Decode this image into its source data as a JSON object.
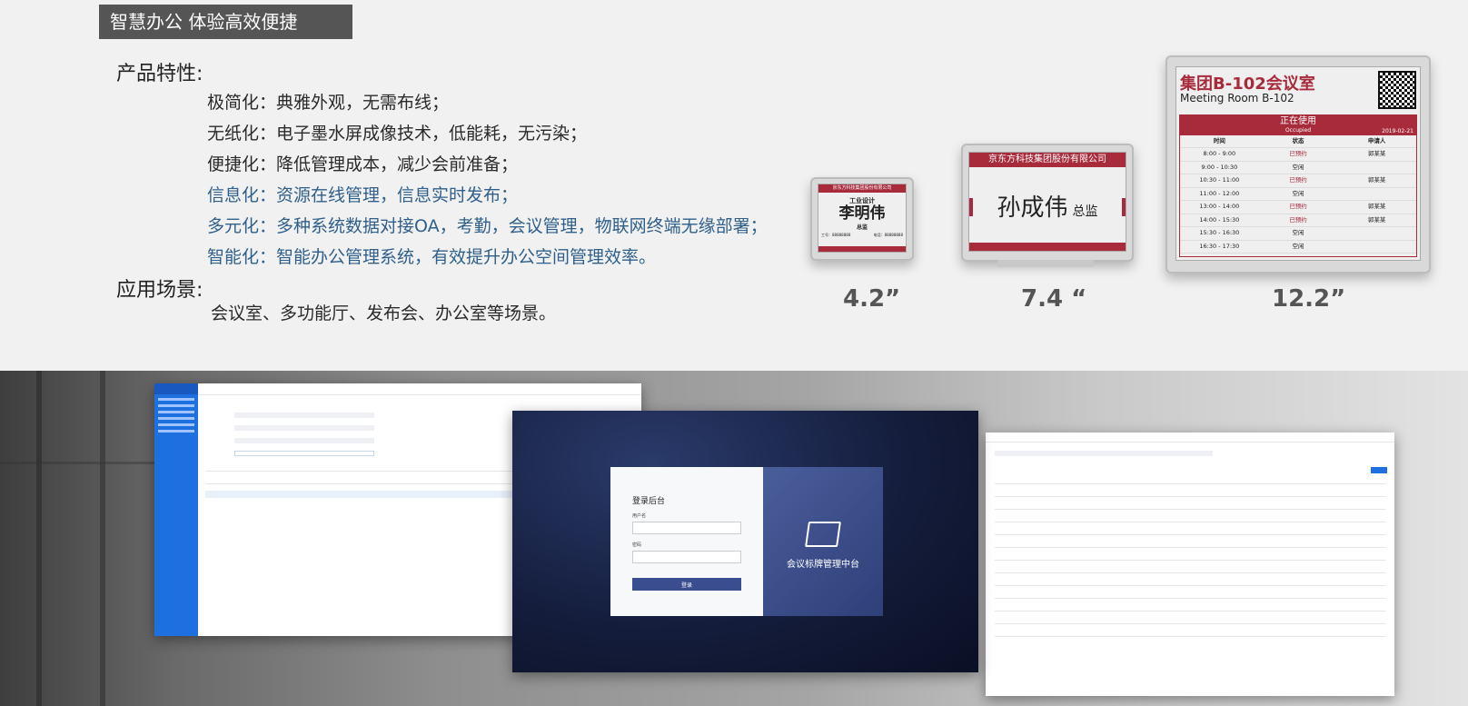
{
  "banner": {
    "title": "智慧办公 体验高效便捷"
  },
  "features": {
    "heading": "产品特性:",
    "items": [
      "极简化：典雅外观，无需布线；",
      "无纸化：电子墨水屏成像技术，低能耗，无污染；",
      "便捷化：降低管理成本，减少会前准备；",
      "信息化：资源在线管理，信息实时发布；",
      "多元化：多种系统数据对接OA，考勤，会议管理，物联网终端无缘部署；",
      "智能化：智能办公管理系统，有效提升办公空间管理效率。"
    ]
  },
  "scenes": {
    "heading": "应用场景:",
    "text": "会议室、多功能厅、发布会、办公室等场景。"
  },
  "devices": {
    "small": {
      "company": "京东方科技集团股份有限公司",
      "dept": "工业设计",
      "name": "李明伟",
      "title": "总监",
      "id_label": "工号：88888888",
      "phone_label": "电话：88888888",
      "size": "4.2”"
    },
    "medium": {
      "company": "京东方科技集团股份有限公司",
      "name": "孙成伟",
      "title": "总监",
      "size": "7.4 “"
    },
    "large": {
      "room_cn": "集团B-102会议室",
      "room_en": "Meeting Room B-102",
      "status": "正在使用",
      "status_en": "Occupied",
      "date": "2019-02-21",
      "headers": [
        "时间",
        "状态",
        "申请人"
      ],
      "rows": [
        [
          "8:00 - 9:00",
          "已预约",
          "郭某某"
        ],
        [
          "9:00 - 10:30",
          "空闲",
          ""
        ],
        [
          "10:30 - 11:00",
          "已预约",
          "郭某某"
        ],
        [
          "11:00 - 12:00",
          "空闲",
          ""
        ],
        [
          "13:00 - 14:00",
          "已预约",
          "郭某某"
        ],
        [
          "14:00 - 15:30",
          "已预约",
          "郭某某"
        ],
        [
          "15:30 - 16:30",
          "空闲",
          ""
        ],
        [
          "16:30 - 17:30",
          "空闲",
          ""
        ]
      ],
      "size": "12.2”"
    }
  },
  "login": {
    "title": "登录后台",
    "user_label": "用户名",
    "pass_label": "密码",
    "button": "登录",
    "platform": "会议标牌管理中台"
  },
  "colors": {
    "brand_red": "#a82b3c",
    "banner_bg": "#555555",
    "feature_blue": "#2f5f8a",
    "admin_blue": "#1e6fe0",
    "login_btn": "#3a4d8f"
  }
}
